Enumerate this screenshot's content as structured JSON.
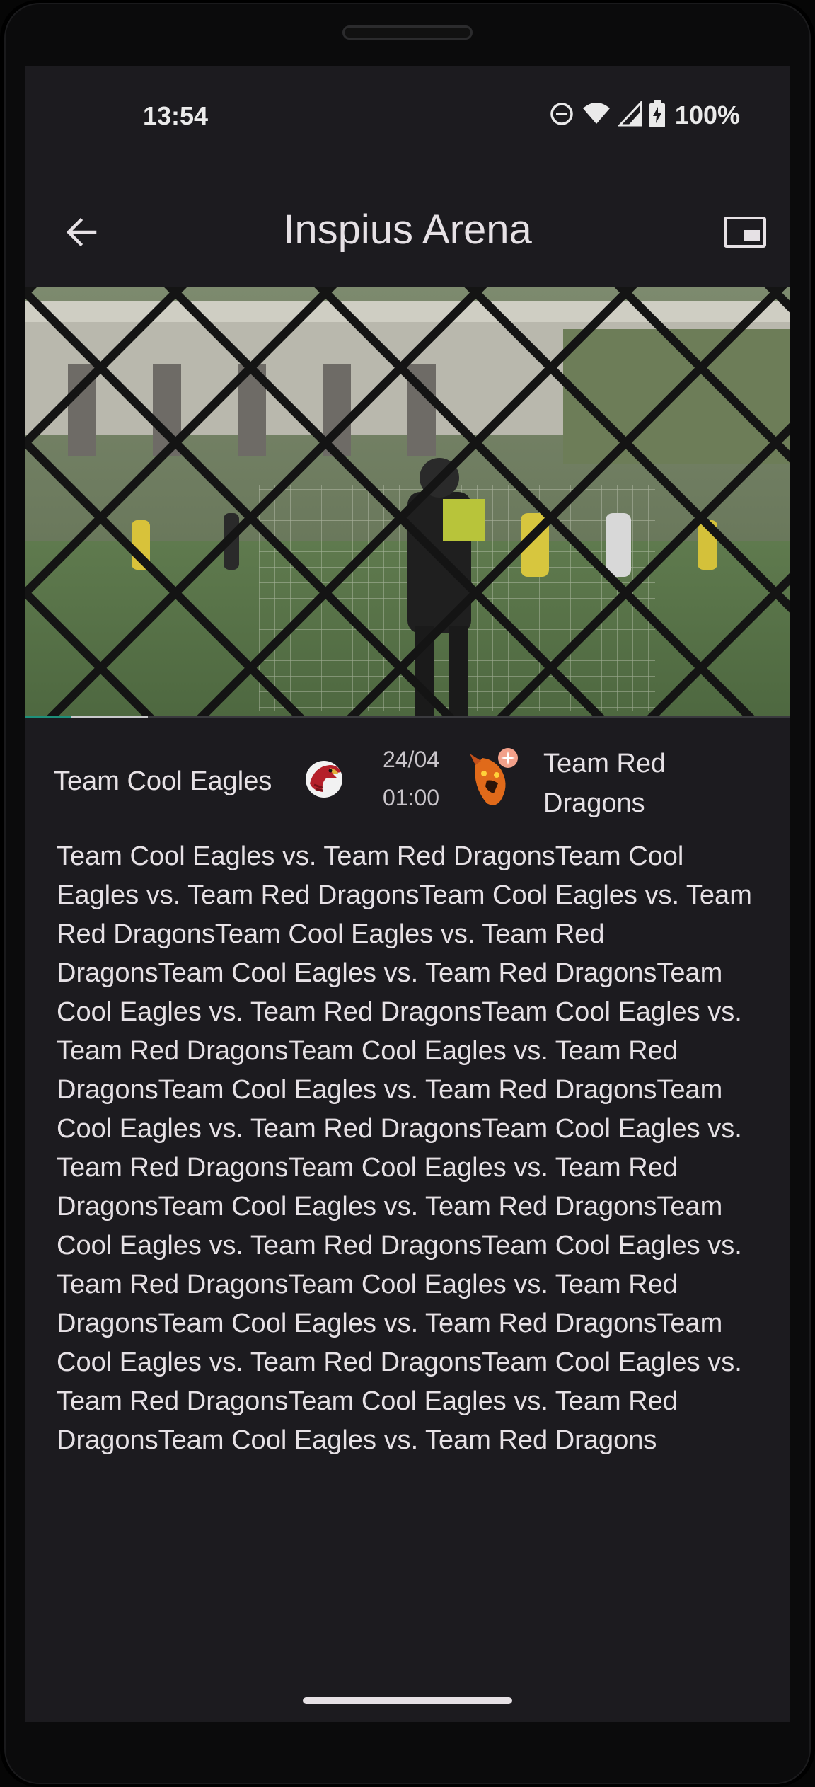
{
  "status_bar": {
    "time": "13:54",
    "battery": "100%",
    "icons": [
      "do-not-disturb-icon",
      "wifi-icon",
      "signal-icon",
      "battery-charging-icon"
    ]
  },
  "app_bar": {
    "title": "Inspius Arena",
    "back_icon": "arrow-back-icon",
    "pip_icon": "picture-in-picture-icon"
  },
  "video": {
    "progress_fraction": 0.16,
    "buffer_fraction": 0.06
  },
  "match": {
    "home_team": "Team Cool Eagles",
    "away_team": "Team Red Dragons",
    "date": "24/04",
    "time": "01:00",
    "home_logo": "eagle-logo-icon",
    "away_logo": "dragon-logo-icon"
  },
  "description": "Team Cool Eagles vs. Team Red DragonsTeam Cool Eagles vs. Team Red DragonsTeam Cool Eagles vs. Team Red DragonsTeam Cool Eagles vs. Team Red DragonsTeam Cool Eagles vs. Team Red DragonsTeam Cool Eagles vs. Team Red DragonsTeam Cool Eagles vs. Team Red DragonsTeam Cool Eagles vs. Team Red DragonsTeam Cool Eagles vs. Team Red DragonsTeam Cool Eagles vs. Team Red DragonsTeam Cool Eagles vs. Team Red DragonsTeam Cool Eagles vs. Team Red DragonsTeam Cool Eagles vs. Team Red DragonsTeam Cool Eagles vs. Team Red DragonsTeam Cool Eagles vs. Team Red DragonsTeam Cool Eagles vs. Team Red DragonsTeam Cool Eagles vs. Team Red DragonsTeam Cool Eagles vs. Team Red DragonsTeam Cool Eagles vs. Team Red DragonsTeam Cool Eagles vs. Team Red DragonsTeam Cool Eagles vs. Team Red Dragons",
  "colors": {
    "screen_bg": "#1c1b1f",
    "text": "#e6e1e5",
    "progress_accent": "#1e8f7a"
  }
}
